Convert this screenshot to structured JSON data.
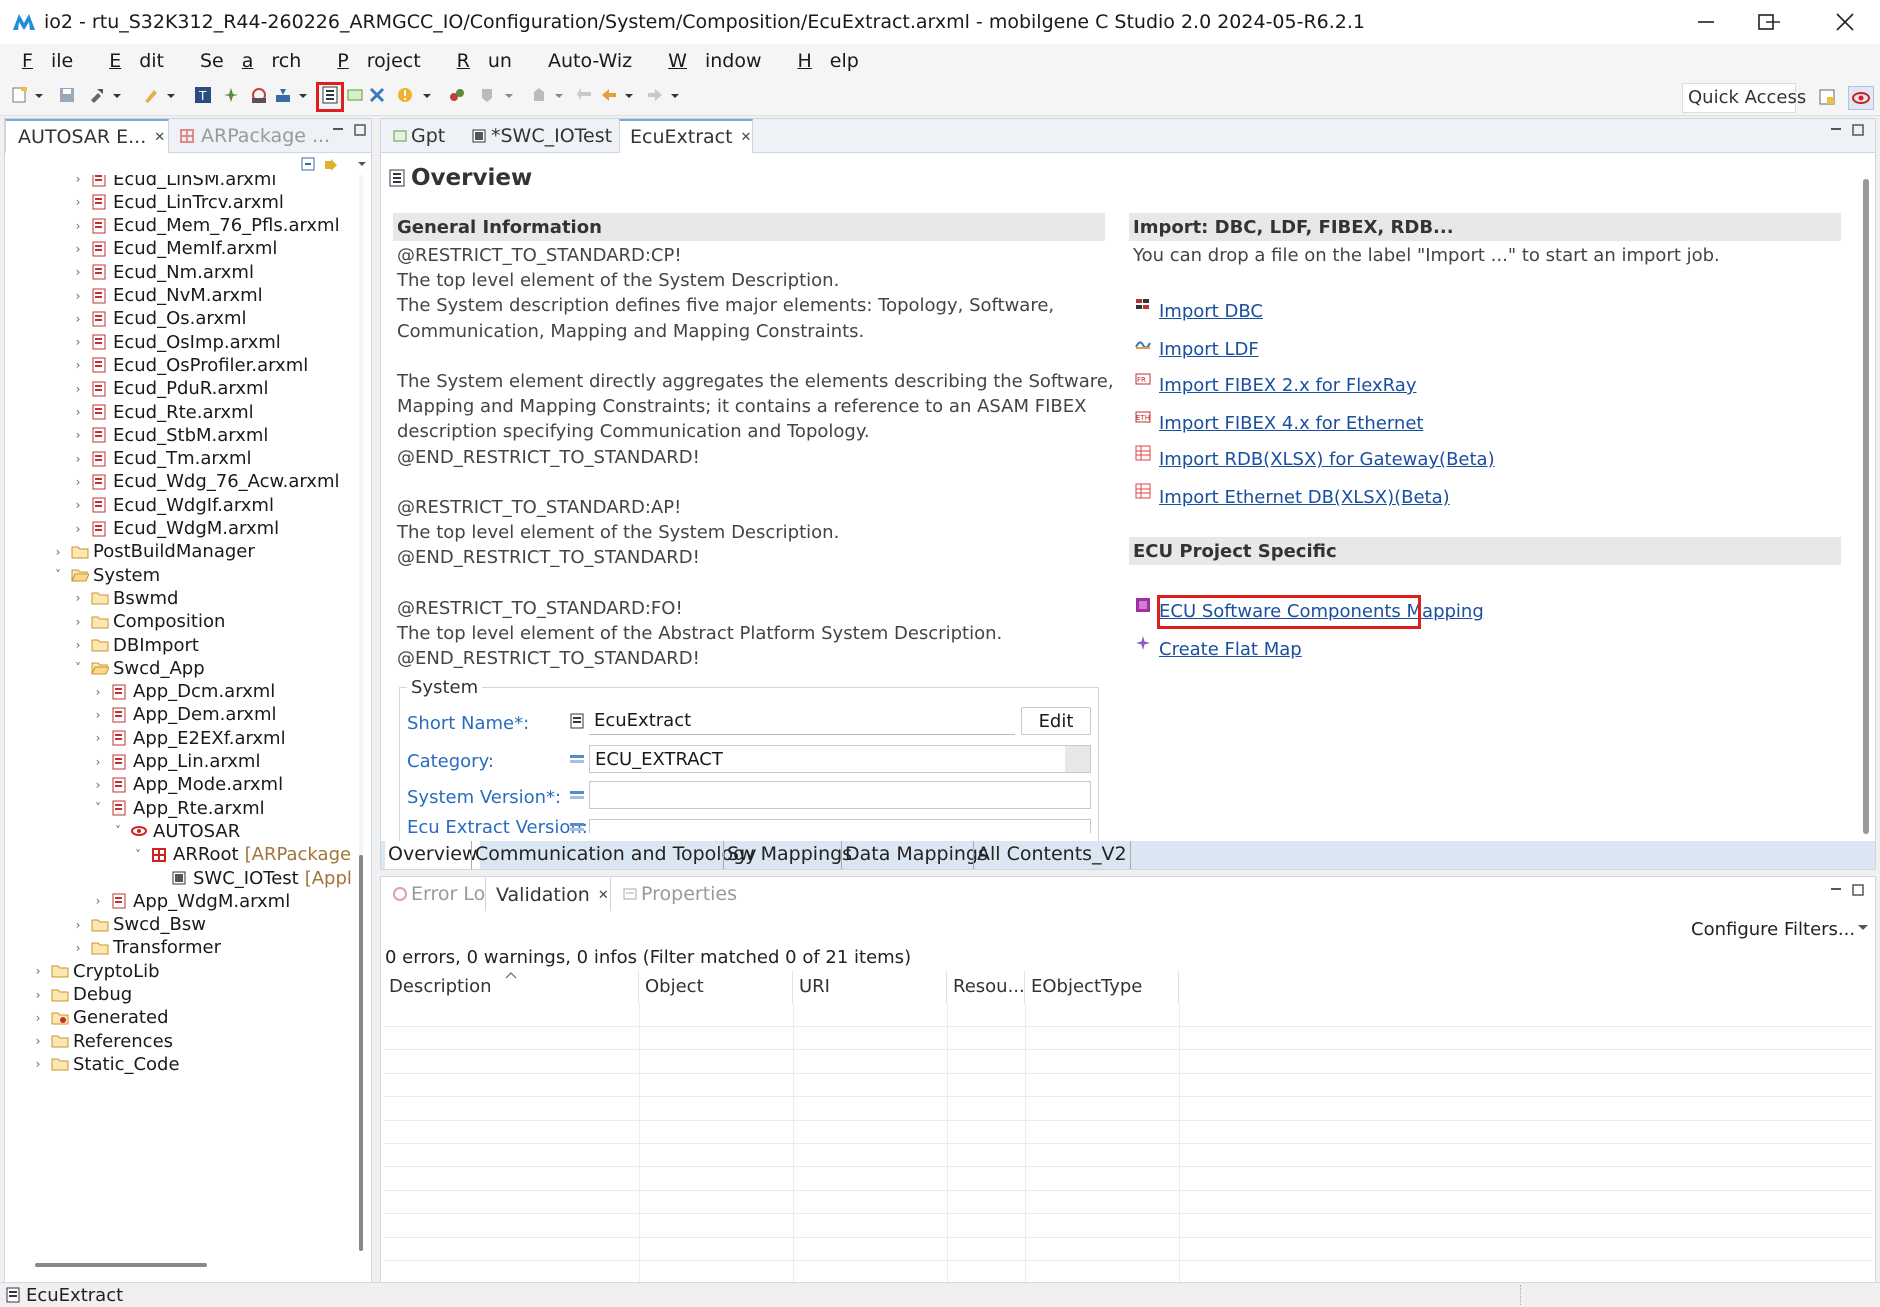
{
  "window": {
    "title": "io2 - rtu_S32K312_R44-260226_ARMGCC_IO/Configuration/System/Composition/EcuExtract.arxml - mobilgene C Studio 2.0 2024-05-R6.2.1",
    "minimize_icon": "minimize-icon",
    "maximize_icon": "maximize-icon",
    "close_icon": "close-icon"
  },
  "menu": [
    {
      "first": "F",
      "rest": "ile"
    },
    {
      "first": "E",
      "rest": "dit"
    },
    {
      "first": "",
      "rest": "Se",
      "u": "a",
      "tail": "rch"
    },
    {
      "first": "P",
      "rest": "roject"
    },
    {
      "first": "R",
      "rest": "un"
    },
    {
      "first": "",
      "rest": "Auto-Wiz"
    },
    {
      "first": "W",
      "rest": "indow"
    },
    {
      "first": "H",
      "rest": "elp"
    }
  ],
  "toolbar": {
    "quick_access": "Quick Access",
    "highlighted_button": "ecu-extract-editor-icon"
  },
  "left_pane": {
    "tabs": [
      {
        "label": "AUTOSAR E...",
        "close": "✕"
      },
      {
        "label": "ARPackage ..."
      }
    ],
    "tree": [
      {
        "label": "Ecud_LinSM.arxml",
        "depth": 3,
        "icon": "arxml-file-icon",
        "exp": "closed"
      },
      {
        "label": "Ecud_LinTrcv.arxml",
        "depth": 3,
        "icon": "arxml-file-icon",
        "exp": "closed"
      },
      {
        "label": "Ecud_Mem_76_Pfls.arxml",
        "depth": 3,
        "icon": "arxml-file-icon",
        "exp": "closed"
      },
      {
        "label": "Ecud_MemIf.arxml",
        "depth": 3,
        "icon": "arxml-file-icon",
        "exp": "closed"
      },
      {
        "label": "Ecud_Nm.arxml",
        "depth": 3,
        "icon": "arxml-file-icon",
        "exp": "closed"
      },
      {
        "label": "Ecud_NvM.arxml",
        "depth": 3,
        "icon": "arxml-file-icon",
        "exp": "closed"
      },
      {
        "label": "Ecud_Os.arxml",
        "depth": 3,
        "icon": "arxml-file-icon",
        "exp": "closed"
      },
      {
        "label": "Ecud_OsImp.arxml",
        "depth": 3,
        "icon": "arxml-file-icon",
        "exp": "closed"
      },
      {
        "label": "Ecud_OsProfiler.arxml",
        "depth": 3,
        "icon": "arxml-file-icon",
        "exp": "closed"
      },
      {
        "label": "Ecud_PduR.arxml",
        "depth": 3,
        "icon": "arxml-file-icon",
        "exp": "closed"
      },
      {
        "label": "Ecud_Rte.arxml",
        "depth": 3,
        "icon": "arxml-file-icon",
        "exp": "closed"
      },
      {
        "label": "Ecud_StbM.arxml",
        "depth": 3,
        "icon": "arxml-file-icon",
        "exp": "closed"
      },
      {
        "label": "Ecud_Tm.arxml",
        "depth": 3,
        "icon": "arxml-file-icon",
        "exp": "closed"
      },
      {
        "label": "Ecud_Wdg_76_Acw.arxml",
        "depth": 3,
        "icon": "arxml-file-icon",
        "exp": "closed"
      },
      {
        "label": "Ecud_WdgIf.arxml",
        "depth": 3,
        "icon": "arxml-file-icon",
        "exp": "closed"
      },
      {
        "label": "Ecud_WdgM.arxml",
        "depth": 3,
        "icon": "arxml-file-icon",
        "exp": "closed"
      },
      {
        "label": "PostBuildManager",
        "depth": 2,
        "icon": "folder-icon",
        "exp": "closed"
      },
      {
        "label": "System",
        "depth": 2,
        "icon": "folder-open-icon",
        "exp": "open"
      },
      {
        "label": "Bswmd",
        "depth": 3,
        "icon": "folder-icon",
        "exp": "closed"
      },
      {
        "label": "Composition",
        "depth": 3,
        "icon": "folder-icon",
        "exp": "closed"
      },
      {
        "label": "DBImport",
        "depth": 3,
        "icon": "folder-icon",
        "exp": "closed"
      },
      {
        "label": "Swcd_App",
        "depth": 3,
        "icon": "folder-open-icon",
        "exp": "open"
      },
      {
        "label": "App_Dcm.arxml",
        "depth": 4,
        "icon": "arxml-file-icon",
        "exp": "closed"
      },
      {
        "label": "App_Dem.arxml",
        "depth": 4,
        "icon": "arxml-file-icon",
        "exp": "closed"
      },
      {
        "label": "App_E2EXf.arxml",
        "depth": 4,
        "icon": "arxml-file-icon",
        "exp": "closed"
      },
      {
        "label": "App_Lin.arxml",
        "depth": 4,
        "icon": "arxml-file-icon",
        "exp": "closed"
      },
      {
        "label": "App_Mode.arxml",
        "depth": 4,
        "icon": "arxml-file-icon",
        "exp": "closed"
      },
      {
        "label": "App_Rte.arxml",
        "depth": 4,
        "icon": "arxml-file-icon",
        "exp": "open"
      },
      {
        "label": "AUTOSAR",
        "depth": 5,
        "icon": "autosar-icon",
        "exp": "open"
      },
      {
        "label": "ARRoot",
        "depth": 6,
        "icon": "package-icon",
        "exp": "open",
        "suffix": "[ARPackage]"
      },
      {
        "label": "SWC_IOTest",
        "depth": 7,
        "icon": "swc-icon",
        "exp": "none",
        "suffix": "[ApplicationSwComponentType]"
      },
      {
        "label": "App_WdgM.arxml",
        "depth": 4,
        "icon": "arxml-file-icon",
        "exp": "closed"
      },
      {
        "label": "Swcd_Bsw",
        "depth": 3,
        "icon": "folder-icon",
        "exp": "closed"
      },
      {
        "label": "Transformer",
        "depth": 3,
        "icon": "folder-icon",
        "exp": "closed"
      },
      {
        "label": "CryptoLib",
        "depth": 1,
        "icon": "folder-icon",
        "exp": "closed"
      },
      {
        "label": "Debug",
        "depth": 1,
        "icon": "folder-icon",
        "exp": "closed"
      },
      {
        "label": "Generated",
        "depth": 1,
        "icon": "folder-gen-icon",
        "exp": "closed"
      },
      {
        "label": "References",
        "depth": 1,
        "icon": "folder-icon",
        "exp": "closed"
      },
      {
        "label": "Static_Code",
        "depth": 1,
        "icon": "folder-icon",
        "exp": "closed"
      }
    ]
  },
  "editor": {
    "tabs": [
      {
        "label": "Gpt"
      },
      {
        "label": "*SWC_IOTest"
      },
      {
        "label": "EcuExtract",
        "close": "✕"
      }
    ],
    "page_title": "Overview",
    "general": {
      "heading": "General Information",
      "text": "@RESTRICT_TO_STANDARD:CP!\nThe top level element of the System Description.\nThe System description defines five major elements: Topology, Software,\nCommunication, Mapping and Mapping Constraints.\n\nThe System element directly aggregates the elements describing the Software,\nMapping and Mapping Constraints; it contains a reference to an ASAM FIBEX\ndescription specifying Communication and Topology.\n@END_RESTRICT_TO_STANDARD!\n\n@RESTRICT_TO_STANDARD:AP!\nThe top level element of the System Description.\n@END_RESTRICT_TO_STANDARD!\n\n@RESTRICT_TO_STANDARD:FO!\nThe top level element of the Abstract Platform System Description.\n@END_RESTRICT_TO_STANDARD!"
    },
    "system_group": {
      "legend": "System",
      "short_name_label": "Short Name*:",
      "short_name_value": "EcuExtract",
      "edit_button": "Edit",
      "category_label": "Category:",
      "category_value": "ECU_EXTRACT",
      "system_version_label": "System Version*:",
      "system_version_value": "",
      "ecu_extract_version_label": "Ecu Extract Version:"
    },
    "import": {
      "heading": "Import: DBC, LDF, FIBEX, RDB...",
      "hint": "You can drop a file on the label \"Import ...\" to start an import job.",
      "links": [
        {
          "label": "Import DBC",
          "icon": "dbc-icon"
        },
        {
          "label": "Import LDF",
          "icon": "ldf-icon"
        },
        {
          "label": "Import FIBEX 2.x for FlexRay",
          "icon": "fibex-flexray-icon"
        },
        {
          "label": "Import FIBEX 4.x for Ethernet",
          "icon": "fibex-ethernet-icon"
        },
        {
          "label": "Import RDB(XLSX) for Gateway(Beta)",
          "icon": "xlsx-icon"
        },
        {
          "label": "Import Ethernet DB(XLSX)(Beta)",
          "icon": "xlsx-icon"
        }
      ]
    },
    "ecu_specific": {
      "heading": "ECU Project Specific",
      "links": [
        {
          "label": "ECU Software Components Mapping",
          "icon": "mapping-icon"
        },
        {
          "label": "Create Flat Map",
          "icon": "sparkle-icon"
        }
      ]
    },
    "bottom_tabs": [
      "Overview",
      "Communication and Topology",
      "Sw Mappings",
      "Data Mappings",
      "All Contents_V2"
    ]
  },
  "bottom_pane": {
    "tabs": [
      {
        "label": "Error Log"
      },
      {
        "label": "Validation",
        "close": "✕"
      },
      {
        "label": "Properties"
      }
    ],
    "configure_filters": "Configure Filters...",
    "summary": "0 errors, 0 warnings, 0 infos (Filter matched 0 of 21 items)",
    "columns": [
      "Description",
      "Object",
      "URI",
      "Resou...",
      "EObjectType"
    ]
  },
  "status_bar": {
    "text": "EcuExtract"
  },
  "colors": {
    "highlight": "#e01e1e",
    "link": "#1a4fa0",
    "label_blue": "#2a6bc0"
  }
}
